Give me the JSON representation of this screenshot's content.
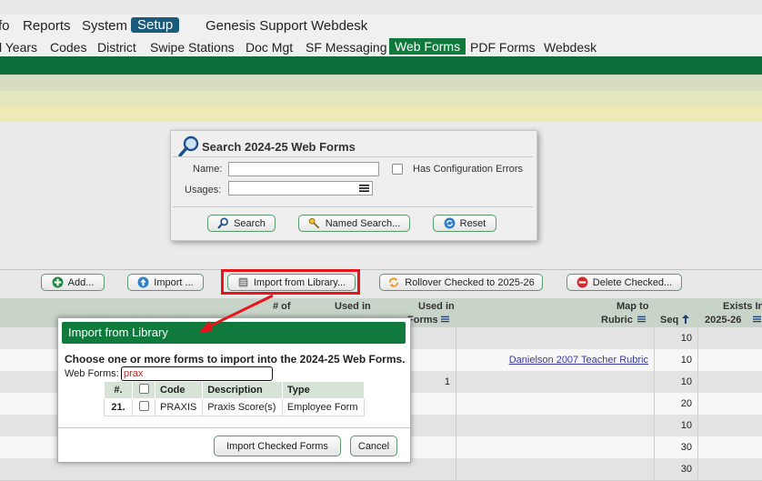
{
  "top_menu": [
    "fo",
    "Reports",
    "System",
    "Setup",
    "Genesis Support",
    "Webdesk"
  ],
  "sub_menu": [
    "l Years",
    "Codes",
    "District",
    "Swipe Stations",
    "Doc Mgt",
    "SF Messaging",
    "Web Forms",
    "PDF Forms",
    "Webdesk"
  ],
  "search": {
    "title": "Search 2024-25 Web Forms",
    "name_label": "Name:",
    "usages_label": "Usages:",
    "config_errors_label": "Has Configuration Errors",
    "search_btn": "Search",
    "named_search_btn": "Named Search...",
    "reset_btn": "Reset"
  },
  "actions": {
    "add": "Add...",
    "import": "Import ...",
    "import_library": "Import from Library...",
    "rollover": "Rollover Checked to 2025-26",
    "delete": "Delete Checked..."
  },
  "columns": {
    "num_of": "# of",
    "used_in_1": "Used in",
    "used_in_2": "Used in",
    "forms": "Forms",
    "map_to": "Map to",
    "rubric": "Rubric",
    "seq": "Seq",
    "exists_in": "Exists In",
    "year": "2025-26"
  },
  "rows": [
    {
      "forms": "",
      "rubric": "",
      "seq": "10"
    },
    {
      "forms": "",
      "rubric": "Danielson 2007 Teacher Rubric",
      "seq": "10"
    },
    {
      "forms": "1",
      "rubric": "",
      "seq": "10"
    },
    {
      "forms": "",
      "rubric": "",
      "seq": "20"
    },
    {
      "forms": "",
      "rubric": "",
      "seq": "10"
    },
    {
      "forms": "",
      "rubric": "",
      "seq": "30"
    },
    {
      "forms": "",
      "rubric": "",
      "seq": "30"
    }
  ],
  "modal": {
    "title": "Import from Library",
    "instruction": "Choose one or more forms to import into the 2024-25 Web Forms.",
    "filter_label": "Web Forms:",
    "filter_value": "prax",
    "table_headers": {
      "num": "#.",
      "code": "Code",
      "description": "Description",
      "type": "Type"
    },
    "rows": [
      {
        "num": "21.",
        "code": "PRAXIS",
        "description": "Praxis Score(s)",
        "type": "Employee Form"
      }
    ],
    "import_btn": "Import Checked Forms",
    "cancel_btn": "Cancel"
  },
  "colors": {
    "brand_green": "#0f7a3c",
    "annotation_red": "#e8141c",
    "link_blue": "#3a3aa8"
  }
}
